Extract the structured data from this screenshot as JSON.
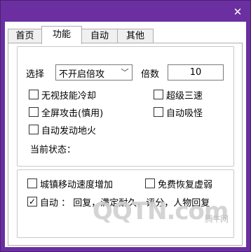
{
  "window": {
    "close_glyph": "✕"
  },
  "tabs": [
    {
      "label": "首页",
      "active": false
    },
    {
      "label": "功能",
      "active": true
    },
    {
      "label": "自动",
      "active": false
    },
    {
      "label": "其他",
      "active": false
    }
  ],
  "main": {
    "select_label": "选择",
    "select_value": "不开启倍攻",
    "multiplier_label": "倍数",
    "multiplier_value": "10",
    "options": [
      {
        "label": "无视技能冷却",
        "checked": false
      },
      {
        "label": "超级三速",
        "checked": false
      },
      {
        "label": "全屏攻击(慎用)",
        "checked": false
      },
      {
        "label": "自动吸怪",
        "checked": false
      },
      {
        "label": "自动发动地火",
        "checked": false
      }
    ],
    "status_label": "当前状态："
  },
  "lower": {
    "options": [
      {
        "label": "城镇移动速度增加",
        "checked": false
      },
      {
        "label": "免费恢复虚弱",
        "checked": false
      }
    ],
    "auto": {
      "label": "自动 ： 回复，满定耐久，评分，人物回复",
      "checked": true
    }
  },
  "watermark": {
    "text": "QQTN.com",
    "sub": "腾牛网"
  }
}
